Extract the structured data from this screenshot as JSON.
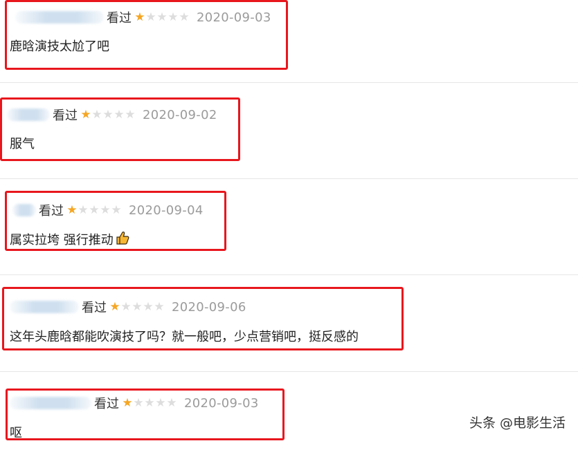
{
  "reviews": [
    {
      "status": "看过",
      "rating": 1,
      "max_rating": 5,
      "date": "2020-09-03",
      "comment": "鹿晗演技太尬了吧"
    },
    {
      "status": "看过",
      "rating": 1,
      "max_rating": 5,
      "date": "2020-09-02",
      "comment": "服气"
    },
    {
      "status": "看过",
      "rating": 1,
      "max_rating": 5,
      "date": "2020-09-04",
      "comment": "属实拉垮 强行推动",
      "emoji": "thumbs-up-icon"
    },
    {
      "status": "看过",
      "rating": 1,
      "max_rating": 5,
      "date": "2020-09-06",
      "comment": "这年头鹿晗都能吹演技了吗？就一般吧，少点营销吧，挺反感的"
    },
    {
      "status": "看过",
      "rating": 1,
      "max_rating": 5,
      "date": "2020-09-03",
      "comment": "呕"
    }
  ],
  "watermark": "头条 @电影生活",
  "colors": {
    "highlight": "#e8161d",
    "star_on": "#f5a623",
    "star_off": "#dddddd",
    "date": "#9b9b9b"
  }
}
